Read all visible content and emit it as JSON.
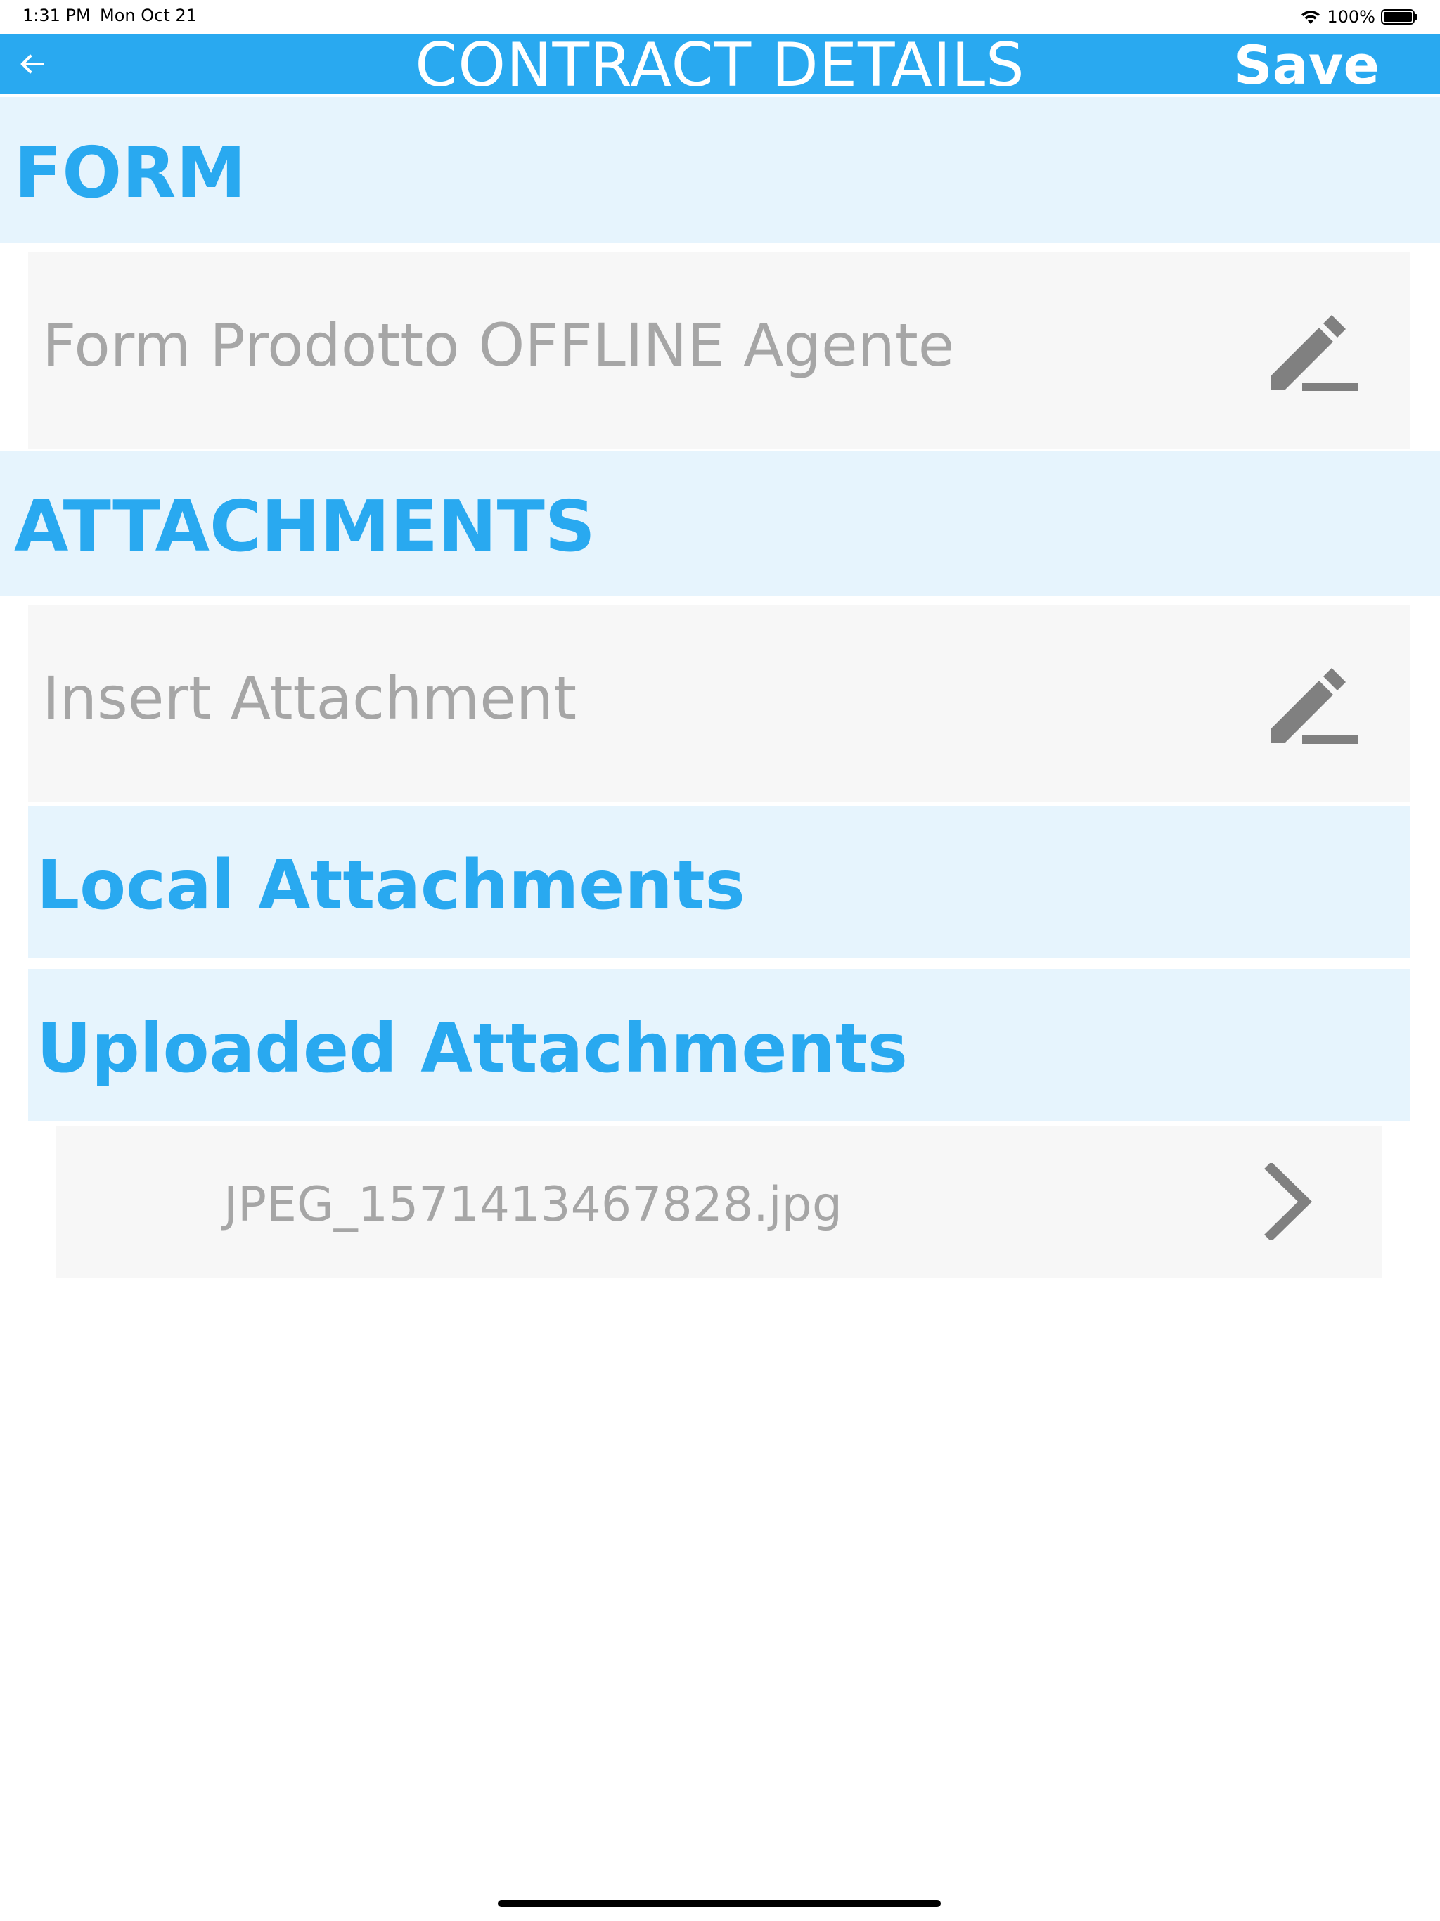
{
  "status_bar": {
    "time": "1:31 PM",
    "date": "Mon Oct 21",
    "battery_pct": "100%",
    "icons": [
      "wifi-icon",
      "battery-icon"
    ]
  },
  "navbar": {
    "title": "CONTRACT DETAILS",
    "save_label": "Save",
    "back_icon": "arrow-left-icon"
  },
  "sections": {
    "form": {
      "header": "FORM",
      "item_label": "Form Prodotto OFFLINE Agente",
      "item_icon": "pencil-icon"
    },
    "attachments": {
      "header": "ATTACHMENTS",
      "insert_label": "Insert Attachment",
      "insert_icon": "pencil-icon",
      "local_header": "Local Attachments",
      "uploaded_header": "Uploaded Attachments",
      "uploaded_files": [
        {
          "name": "JPEG_1571413467828.jpg",
          "icon": "chevron-right-icon"
        }
      ]
    }
  },
  "colors": {
    "accent": "#29a9f0",
    "section_bg": "#e6f4fd",
    "row_bg": "#f7f7f7",
    "muted_text": "#a6a6a6",
    "icon_gray": "#808080"
  }
}
